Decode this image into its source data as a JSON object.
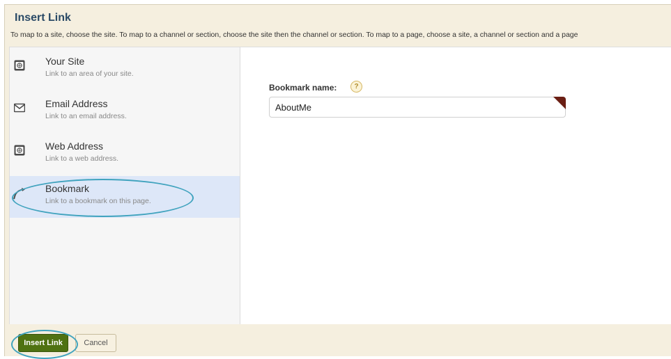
{
  "dialog": {
    "title": "Insert Link",
    "subtitle": "To map to a site, choose the site. To map to a channel or section, choose the site then the channel or section. To map to a page, choose a site, a channel or section and a page"
  },
  "link_types": [
    {
      "label": "Your Site",
      "description": "Link to an area of your site.",
      "icon": "site-icon"
    },
    {
      "label": "Email Address",
      "description": "Link to an email address.",
      "icon": "envelope-icon"
    },
    {
      "label": "Web Address",
      "description": "Link to a web address.",
      "icon": "web-icon"
    },
    {
      "label": "Bookmark",
      "description": "Link to a bookmark on this page.",
      "icon": "bookmark-icon",
      "selected": true
    }
  ],
  "bookmark_field": {
    "label": "Bookmark name:",
    "help": "?",
    "value": "AboutMe"
  },
  "buttons": {
    "insert": "Insert Link",
    "cancel": "Cancel"
  },
  "colors": {
    "accent_green": "#4f7212",
    "highlight_ring": "#40a3be",
    "selected_bg": "#dde7f8",
    "title": "#2a4a66"
  }
}
